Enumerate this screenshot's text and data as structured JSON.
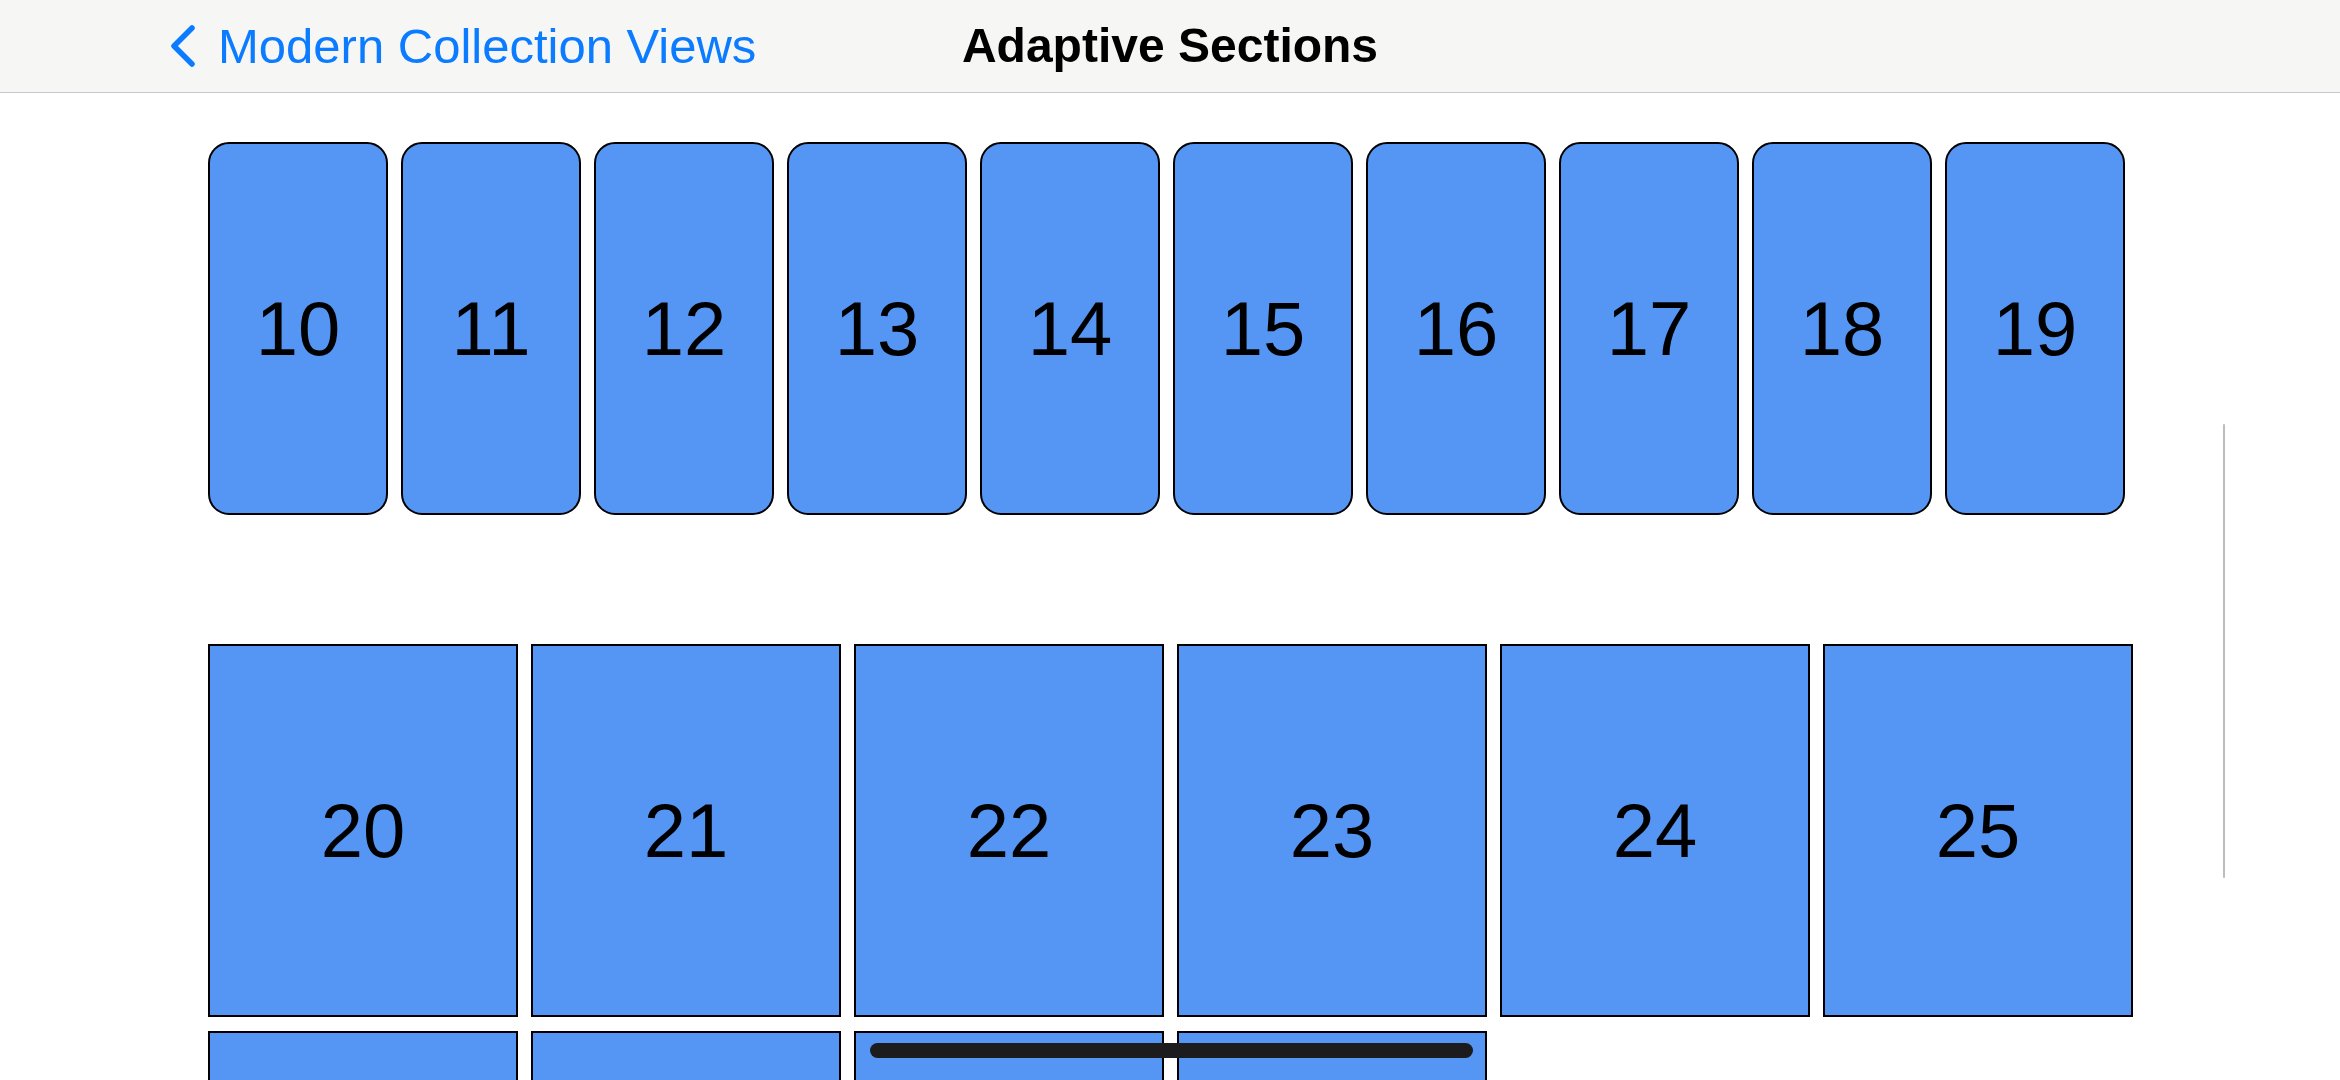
{
  "navigation_bar": {
    "back_button": {
      "label": "Modern Collection Views"
    },
    "title": "Adaptive Sections"
  },
  "sections": [
    {
      "kind": "rounded",
      "cells": [
        {
          "label": "10"
        },
        {
          "label": "11"
        },
        {
          "label": "12"
        },
        {
          "label": "13"
        },
        {
          "label": "14"
        },
        {
          "label": "15"
        },
        {
          "label": "16"
        },
        {
          "label": "17"
        },
        {
          "label": "18"
        },
        {
          "label": "19"
        }
      ]
    },
    {
      "kind": "square",
      "cells": [
        {
          "label": "20"
        },
        {
          "label": "21"
        },
        {
          "label": "22"
        },
        {
          "label": "23"
        },
        {
          "label": "24"
        },
        {
          "label": "25"
        },
        {},
        {},
        {},
        {}
      ]
    }
  ]
}
